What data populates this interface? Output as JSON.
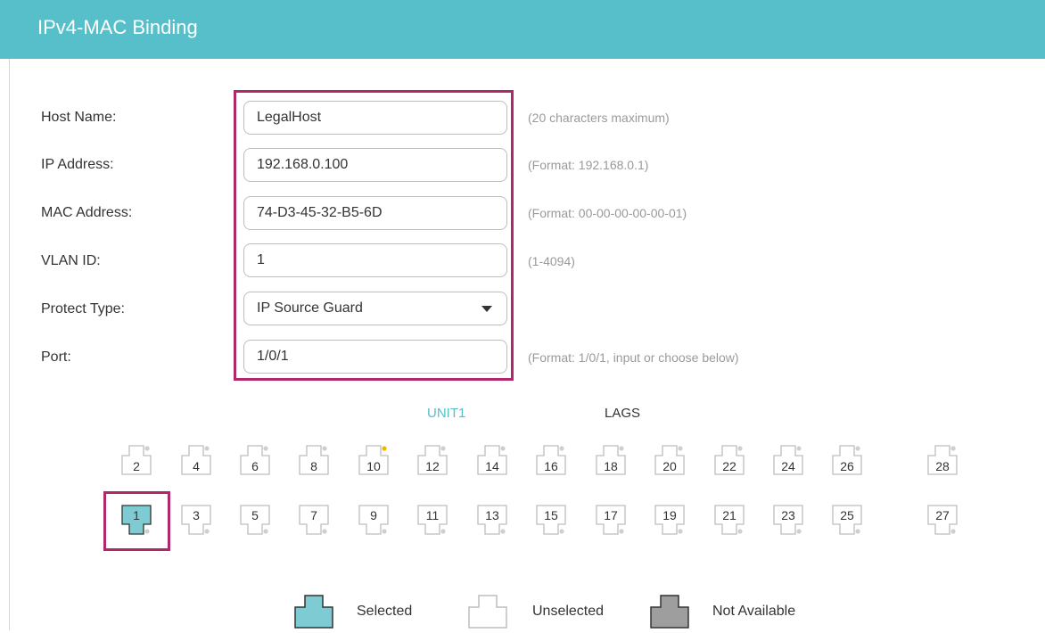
{
  "header": {
    "title": "IPv4-MAC Binding"
  },
  "form": {
    "host_name": {
      "label": "Host Name:",
      "value": "LegalHost",
      "hint": "(20 characters maximum)"
    },
    "ip_address": {
      "label": "IP Address:",
      "value": "192.168.0.100",
      "hint": "(Format: 192.168.0.1)"
    },
    "mac_address": {
      "label": "MAC Address:",
      "value": "74-D3-45-32-B5-6D",
      "hint": "(Format: 00-00-00-00-00-01)"
    },
    "vlan_id": {
      "label": "VLAN ID:",
      "value": "1",
      "hint": "(1-4094)"
    },
    "protect_type": {
      "label": "Protect Type:",
      "value": "IP Source Guard"
    },
    "port": {
      "label": "Port:",
      "value": "1/0/1",
      "hint": "(Format: 1/0/1, input or choose below)"
    }
  },
  "tabs": {
    "unit1": "UNIT1",
    "lags": "LAGS"
  },
  "ports": {
    "top_row": [
      "2",
      "4",
      "6",
      "8",
      "10",
      "12",
      "14",
      "16",
      "18",
      "20",
      "22",
      "24",
      "26",
      "28"
    ],
    "bottom_row": [
      "1",
      "3",
      "5",
      "7",
      "9",
      "11",
      "13",
      "15",
      "17",
      "19",
      "21",
      "23",
      "25",
      "27"
    ],
    "selected": [
      "1"
    ],
    "link_up": [
      "10"
    ]
  },
  "legend": {
    "selected": "Selected",
    "unselected": "Unselected",
    "not_available": "Not Available"
  },
  "colors": {
    "accent": "#56bfc9",
    "highlight": "#b0276a",
    "selected_fill": "#7fcbd3",
    "not_available_fill": "#9e9e9e",
    "link_up": "#f5b400"
  }
}
